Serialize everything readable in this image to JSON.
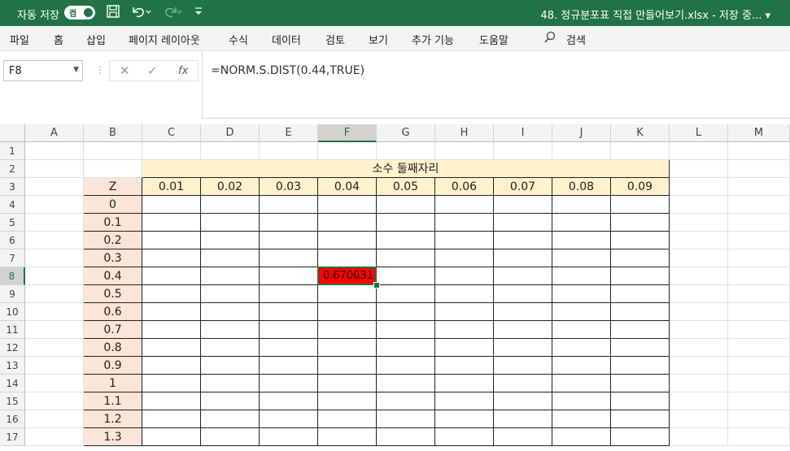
{
  "titlebar": {
    "autosave_label": "자동 저장",
    "autosave_state": "켬",
    "file_title": "48. 정규분포표 직접 만들어보기.xlsx - 저장 중... ▾",
    "icons": [
      "save-icon",
      "undo-icon",
      "redo-icon",
      "customize-qat-icon"
    ]
  },
  "ribbon": {
    "tabs": [
      "파일",
      "홈",
      "삽입",
      "페이지 레이아웃",
      "수식",
      "데이터",
      "검토",
      "보기",
      "추가 기능",
      "도움말"
    ],
    "search_label": "검색"
  },
  "formula_bar": {
    "name_box": "F8",
    "fx_label": "fx",
    "formula": "=NORM.S.DIST(0.44,TRUE)"
  },
  "sheet": {
    "columns": [
      "A",
      "B",
      "C",
      "D",
      "E",
      "F",
      "G",
      "H",
      "I",
      "J",
      "K",
      "L",
      "M"
    ],
    "selected_column": "F",
    "rows": [
      "1",
      "2",
      "3",
      "4",
      "5",
      "6",
      "7",
      "8",
      "9",
      "10",
      "11",
      "12",
      "13",
      "14",
      "15",
      "16",
      "17"
    ],
    "selected_row": "8",
    "header_title": "소수 둘째자리",
    "z_label": "Z",
    "decimals": [
      "0.01",
      "0.02",
      "0.03",
      "0.04",
      "0.05",
      "0.06",
      "0.07",
      "0.08",
      "0.09"
    ],
    "z_values": [
      "0",
      "0.1",
      "0.2",
      "0.3",
      "0.4",
      "0.5",
      "0.6",
      "0.7",
      "0.8",
      "0.9",
      "1",
      "1.1",
      "1.2",
      "1.3"
    ],
    "active_cell_value": "0.670031",
    "colors": {
      "header_fill": "#fff2cc",
      "z_fill": "#fce4d6",
      "active_fill": "#ff0000",
      "accent": "#217346"
    }
  }
}
